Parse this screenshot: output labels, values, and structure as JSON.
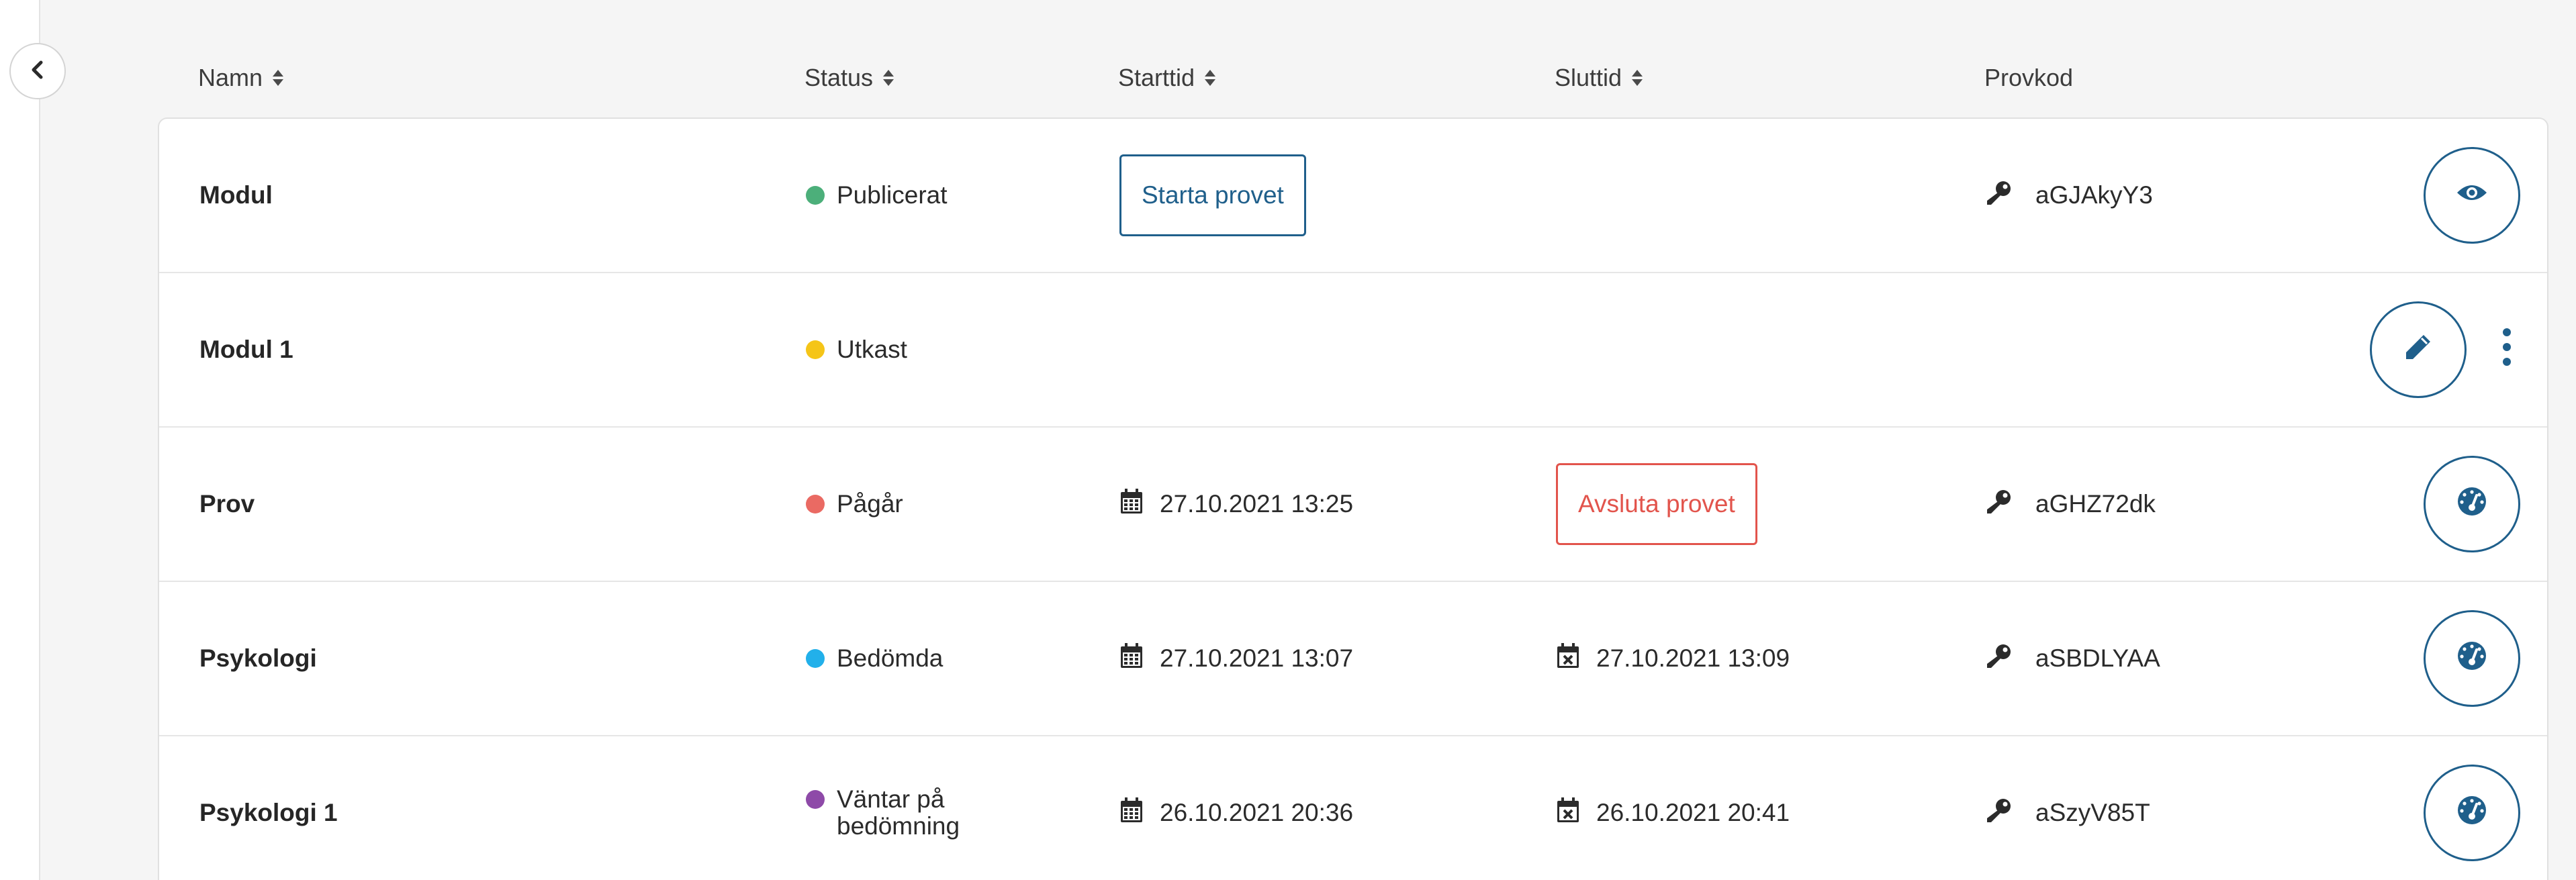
{
  "sidebar": {
    "collapse_icon": "chevron-left-icon"
  },
  "table": {
    "columns": [
      {
        "key": "name",
        "label": "Namn",
        "sortable": true
      },
      {
        "key": "status",
        "label": "Status",
        "sortable": true
      },
      {
        "key": "start",
        "label": "Starttid",
        "sortable": true
      },
      {
        "key": "end",
        "label": "Sluttid",
        "sortable": true
      },
      {
        "key": "code",
        "label": "Provkod",
        "sortable": false
      }
    ],
    "rows": [
      {
        "name": "Modul",
        "status": "Publicerat",
        "status_color": "#4caf7a",
        "start_button": "Starta provet",
        "code": "aGJAkyY3",
        "action_icon": "eye-icon"
      },
      {
        "name": "Modul 1",
        "status": "Utkast",
        "status_color": "#f5c518",
        "action_icon": "pencil-icon",
        "more_icon": "more-vertical-icon"
      },
      {
        "name": "Prov",
        "status": "Pågår",
        "status_color": "#ea6a63",
        "start": "27.10.2021 13:25",
        "end_button": "Avsluta provet",
        "code": "aGHZ72dk",
        "action_icon": "speedometer-icon"
      },
      {
        "name": "Psykologi",
        "status": "Bedömda",
        "status_color": "#22b0ea",
        "start": "27.10.2021 13:07",
        "end": "27.10.2021 13:09",
        "code": "aSBDLYAA",
        "action_icon": "speedometer-icon"
      },
      {
        "name": "Psykologi 1",
        "status": "Väntar på bedömning",
        "status_color": "#8e4aa8",
        "start": "26.10.2021 20:36",
        "end": "26.10.2021 20:41",
        "code": "aSzyV85T",
        "action_icon": "speedometer-icon"
      }
    ]
  },
  "colors": {
    "primary": "#1f5f8b",
    "danger": "#e2544c",
    "icon_dark": "#2b2b2b"
  }
}
